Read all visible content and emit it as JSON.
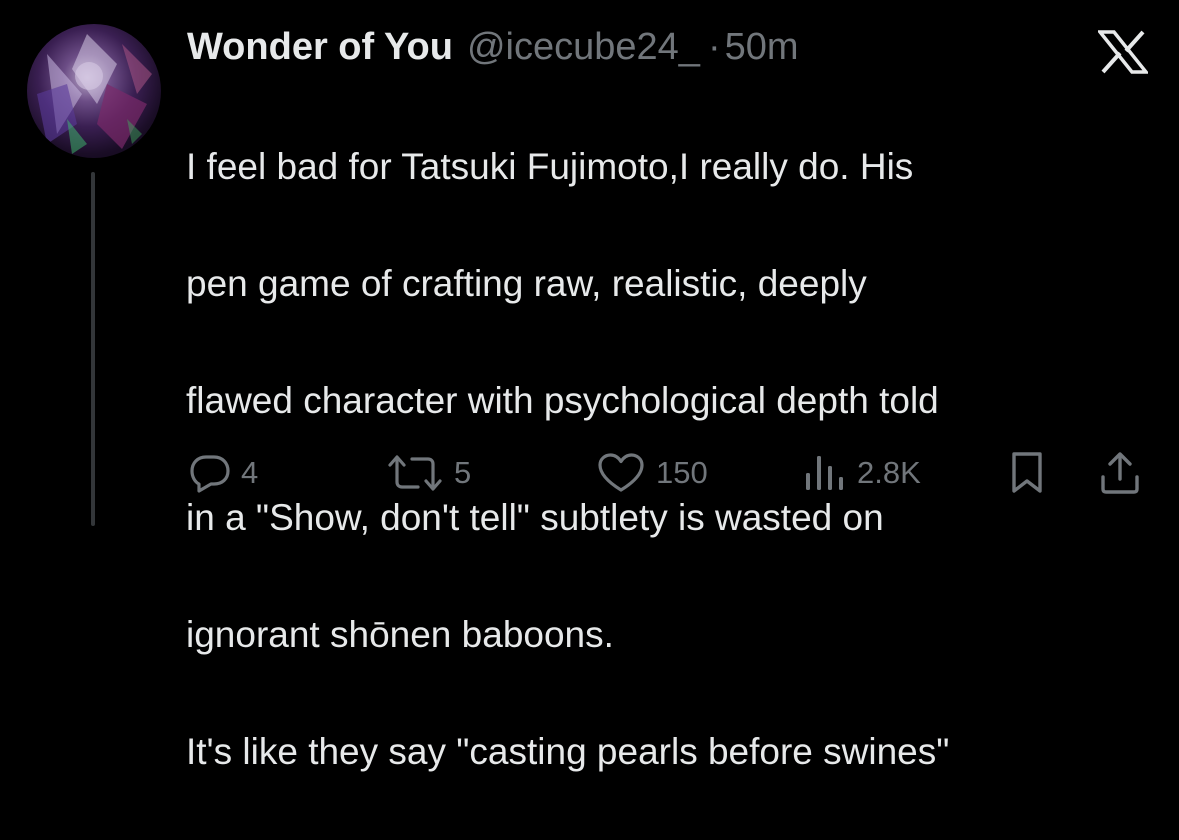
{
  "author": {
    "display_name": "Wonder of You",
    "handle": "@icecube24_",
    "separator": "·",
    "time": "50m"
  },
  "platform_logo": "x-logo-icon",
  "tweet": {
    "lines": [
      "I feel bad for Tatsuki Fujimoto,I really do. His",
      "pen game of crafting raw, realistic, deeply",
      "flawed character with psychological depth told",
      "in a \"Show, don't tell\" subtlety is wasted on",
      "ignorant shōnen baboons.",
      "It's like they say \"casting pearls before swines\""
    ]
  },
  "actions": {
    "replies": "4",
    "retweets": "5",
    "likes": "150",
    "views": "2.8K"
  },
  "icons": [
    "reply-icon",
    "retweet-icon",
    "like-icon",
    "views-icon",
    "bookmark-icon",
    "share-icon"
  ],
  "colors": {
    "background": "#000000",
    "text": "#e7e9ea",
    "muted": "#71767b",
    "thread_line": "#333639"
  }
}
